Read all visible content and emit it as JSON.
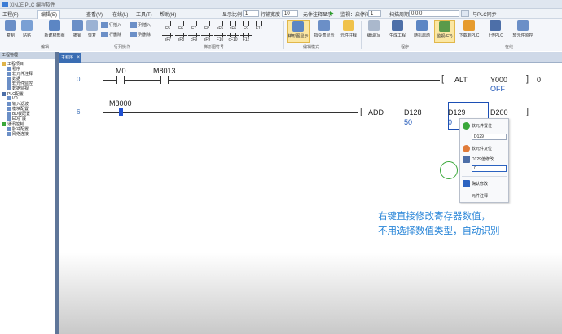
{
  "window": {
    "title": "XINJE PLC 编程软件"
  },
  "menu": {
    "items": [
      "工程(F)",
      "编辑(E)",
      "查看(V)",
      "在线(L)",
      "工具(T)",
      "帮助(H)"
    ],
    "active": "编辑(E)",
    "display_ratio_label": "显示比例",
    "display_ratio_value": "1",
    "row_width_label": "行输宽度",
    "row_width_value": "10",
    "view_mode_label": "元件注释显示",
    "monitor_label": "监视：启停间隔",
    "monitor_value": "1",
    "stop_label": "扫描周期",
    "stop_value": "0.0.0",
    "sync_label": "与PLC同步"
  },
  "ribbon": {
    "groups": [
      "编辑",
      "行列操作",
      "梯形图符号",
      "编辑模式",
      "程序",
      "在线"
    ],
    "buttons": [
      {
        "label": "复制",
        "color": "#6b8fc7"
      },
      {
        "label": "粘贴",
        "color": "#7aa0d4"
      },
      {
        "label": "新建梯形图",
        "color": "#5c86c4"
      },
      {
        "label": "撤销",
        "color": "#6b8fc7"
      },
      {
        "label": "恢复",
        "color": "#9bb2d4"
      }
    ],
    "row_ops": [
      "行插入",
      "列插入",
      "行删除",
      "列删除"
    ],
    "ladder_keys": [
      "F5",
      "F6",
      "F7",
      "F8",
      "sF5",
      "sF6",
      "F9",
      "sF7",
      "sF8",
      "cF9",
      "sF9",
      "F10",
      "cF10",
      "F11",
      "F12"
    ],
    "edit_mode": [
      "梯形图显示",
      "指令表显示",
      "元件注释"
    ],
    "program": [
      "编译/写",
      "生成工程",
      "随机启动",
      "监视(F2)",
      "下载到PLC"
    ],
    "online": [
      "上传PLC",
      "软元件监控"
    ]
  },
  "left_panel": {
    "header": "工程管理",
    "tree": [
      "工程项目",
      "程序",
      "软元件注释",
      "数据",
      "软元件监控",
      "数据监视",
      "PLC配置",
      "I/O",
      "输入滤波",
      "模块配置",
      "BD板配置",
      "ED扩展",
      "通讯控制",
      "脉冲配置",
      "网络连接"
    ]
  },
  "editor": {
    "tab_label": "主程序",
    "rungs": [
      {
        "step": "0",
        "contacts": [
          {
            "name": "M0"
          },
          {
            "name": "M8013"
          }
        ],
        "instruction": "ALT",
        "operands": [
          {
            "name": "Y000",
            "value": "OFF"
          }
        ],
        "right_value": "0"
      },
      {
        "step": "6",
        "contacts": [
          {
            "name": "M8000"
          }
        ],
        "instruction": "ADD",
        "operands": [
          {
            "name": "D128",
            "value": "50"
          },
          {
            "name": "D129",
            "value": "0"
          },
          {
            "name": "D200",
            "value": ""
          }
        ]
      }
    ]
  },
  "context_menu": {
    "items": [
      {
        "label": "软元件置位",
        "icon": "set-icon",
        "color": "#3aa83a"
      },
      {
        "label": "D129",
        "is_field": true
      },
      {
        "label": "软元件复位",
        "icon": "reset-icon",
        "color": "#e07b39"
      },
      {
        "label": "D129值修改",
        "icon": "pencil-icon",
        "color": "#4d6fa8"
      },
      {
        "label": "0",
        "is_field": true
      },
      {
        "label": "确认修改",
        "icon": "check-icon",
        "color": "#2b62c0"
      },
      {
        "label": "元件注释",
        "icon": "",
        "color": ""
      }
    ]
  },
  "caption": {
    "line1": "右键直接修改寄存器数值，",
    "line2": "不用选择数值类型，自动识别"
  }
}
